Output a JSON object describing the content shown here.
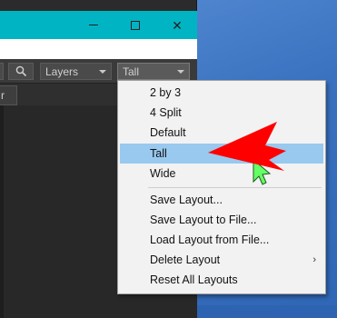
{
  "toolbar": {
    "layers_label": "Layers",
    "layout_label": "Tall"
  },
  "tab": {
    "label": "r"
  },
  "menu": {
    "items": [
      {
        "label": "2 by 3"
      },
      {
        "label": "4 Split"
      },
      {
        "label": "Default"
      },
      {
        "label": "Tall",
        "highlighted": true
      },
      {
        "label": "Wide"
      },
      {
        "label": "Save Layout..."
      },
      {
        "label": "Save Layout to File..."
      },
      {
        "label": "Load Layout from File..."
      },
      {
        "label": "Delete Layout",
        "has_submenu": true
      },
      {
        "label": "Reset All Layouts"
      }
    ],
    "submenu_arrow": "›"
  },
  "colors": {
    "titlebar": "#00b4c4",
    "highlight": "#99c9ef",
    "annotation_arrow": "#ff0000",
    "cursor": "#66ff66"
  },
  "icons": {
    "search": "search-icon",
    "cursor": "mouse-cursor-icon",
    "annotation": "red-arrow-annotation"
  }
}
